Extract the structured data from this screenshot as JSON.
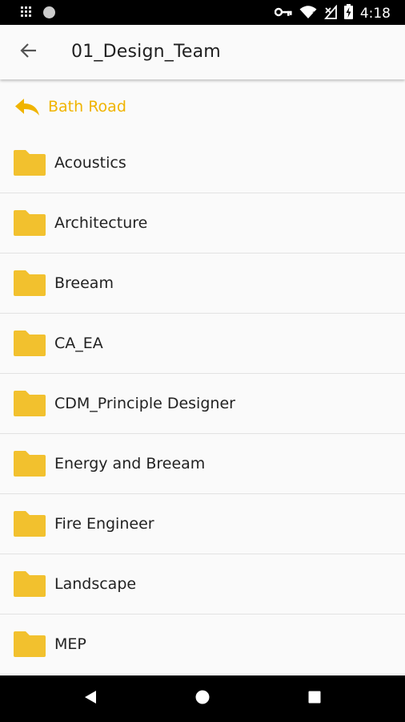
{
  "status_bar": {
    "time": "4:18",
    "icons": [
      "grid-notification-icon",
      "circle-notification-icon",
      "vpn-key-icon",
      "wifi-icon",
      "no-signal-icon",
      "battery-icon"
    ]
  },
  "header": {
    "title": "01_Design_Team",
    "back_icon": "arrow-back-icon"
  },
  "parent": {
    "label": "Bath Road",
    "icon": "reply-arrow-icon"
  },
  "folders": [
    {
      "label": "Acoustics"
    },
    {
      "label": "Architecture"
    },
    {
      "label": "Breeam"
    },
    {
      "label": "CA_EA"
    },
    {
      "label": "CDM_Principle Designer"
    },
    {
      "label": "Energy and Breeam"
    },
    {
      "label": "Fire Engineer"
    },
    {
      "label": "Landscape"
    },
    {
      "label": "MEP"
    }
  ],
  "nav_bar": {
    "buttons": [
      "back-triangle-icon",
      "home-circle-icon",
      "recents-square-icon"
    ]
  },
  "colors": {
    "accent": "#f0b400",
    "folder": "#f2c12e",
    "status_bar": "#000000",
    "background": "#fafafa"
  }
}
